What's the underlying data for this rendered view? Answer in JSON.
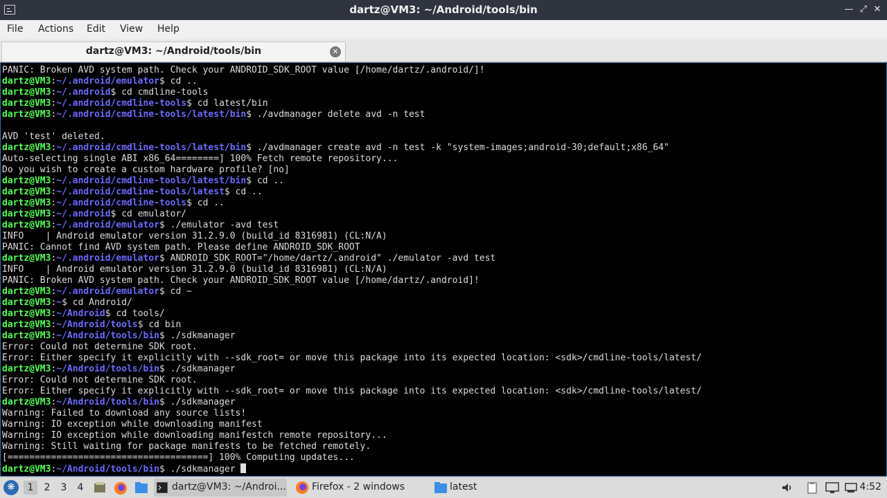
{
  "window": {
    "title": "dartz@VM3: ~/Android/tools/bin",
    "controls": [
      "minimize-icon",
      "maximize-icon",
      "close-icon"
    ]
  },
  "menu": [
    "File",
    "Actions",
    "Edit",
    "View",
    "Help"
  ],
  "tab": {
    "label": "dartz@VM3: ~/Android/tools/bin"
  },
  "terminal": {
    "lines": [
      {
        "text": "PANIC: Broken AVD system path. Check your ANDROID_SDK_ROOT value [/home/dartz/.android/]!"
      },
      {
        "user": "dartz@VM3",
        "path": "~/.android/emulator",
        "cmd": " cd .."
      },
      {
        "user": "dartz@VM3",
        "path": "~/.android",
        "cmd": " cd cmdline-tools"
      },
      {
        "user": "dartz@VM3",
        "path": "~/.android/cmdline-tools",
        "cmd": " cd latest/bin"
      },
      {
        "user": "dartz@VM3",
        "path": "~/.android/cmdline-tools/latest/bin",
        "cmd": " ./avdmanager delete avd -n test"
      },
      {
        "text": ""
      },
      {
        "text": "AVD 'test' deleted."
      },
      {
        "user": "dartz@VM3",
        "path": "~/.android/cmdline-tools/latest/bin",
        "cmd": " ./avdmanager create avd -n test -k \"system-images;android-30;default;x86_64\""
      },
      {
        "text": "Auto-selecting single ABI x86_64========] 100% Fetch remote repository..."
      },
      {
        "text": "Do you wish to create a custom hardware profile? [no]"
      },
      {
        "user": "dartz@VM3",
        "path": "~/.android/cmdline-tools/latest/bin",
        "cmd": " cd .."
      },
      {
        "user": "dartz@VM3",
        "path": "~/.android/cmdline-tools/latest",
        "cmd": " cd .."
      },
      {
        "user": "dartz@VM3",
        "path": "~/.android/cmdline-tools",
        "cmd": " cd .."
      },
      {
        "user": "dartz@VM3",
        "path": "~/.android",
        "cmd": " cd emulator/"
      },
      {
        "user": "dartz@VM3",
        "path": "~/.android/emulator",
        "cmd": " ./emulator -avd test"
      },
      {
        "text": "INFO    | Android emulator version 31.2.9.0 (build_id 8316981) (CL:N/A)"
      },
      {
        "text": "PANIC: Cannot find AVD system path. Please define ANDROID_SDK_ROOT"
      },
      {
        "user": "dartz@VM3",
        "path": "~/.android/emulator",
        "cmd": " ANDROID_SDK_ROOT=\"/home/dartz/.android\" ./emulator -avd test"
      },
      {
        "text": "INFO    | Android emulator version 31.2.9.0 (build_id 8316981) (CL:N/A)"
      },
      {
        "text": "PANIC: Broken AVD system path. Check your ANDROID_SDK_ROOT value [/home/dartz/.android]!"
      },
      {
        "user": "dartz@VM3",
        "path": "~/.android/emulator",
        "cmd": " cd ~"
      },
      {
        "user": "dartz@VM3",
        "path": "~",
        "cmd": " cd Android/"
      },
      {
        "user": "dartz@VM3",
        "path": "~/Android",
        "cmd": " cd tools/"
      },
      {
        "user": "dartz@VM3",
        "path": "~/Android/tools",
        "cmd": " cd bin"
      },
      {
        "user": "dartz@VM3",
        "path": "~/Android/tools/bin",
        "cmd": " ./sdkmanager"
      },
      {
        "text": "Error: Could not determine SDK root."
      },
      {
        "text": "Error: Either specify it explicitly with --sdk_root= or move this package into its expected location: <sdk>/cmdline-tools/latest/"
      },
      {
        "user": "dartz@VM3",
        "path": "~/Android/tools/bin",
        "cmd": " ./sdkmanager"
      },
      {
        "text": "Error: Could not determine SDK root."
      },
      {
        "text": "Error: Either specify it explicitly with --sdk_root= or move this package into its expected location: <sdk>/cmdline-tools/latest/"
      },
      {
        "user": "dartz@VM3",
        "path": "~/Android/tools/bin",
        "cmd": " ./sdkmanager"
      },
      {
        "text": "Warning: Failed to download any source lists!"
      },
      {
        "text": "Warning: IO exception while downloading manifest"
      },
      {
        "text": "Warning: IO exception while downloading manifestch remote repository..."
      },
      {
        "text": "Warning: Still waiting for package manifests to be fetched remotely."
      },
      {
        "text": "[=====================================] 100% Computing updates..."
      },
      {
        "user": "dartz@VM3",
        "path": "~/Android/tools/bin",
        "cmd": " ./sdkmanager ",
        "cursor": true
      }
    ]
  },
  "taskbar": {
    "workspaces": [
      "1",
      "2",
      "3",
      "4"
    ],
    "active_workspace": "1",
    "launchers": [
      "file-manager-icon",
      "firefox-icon",
      "folder-icon"
    ],
    "tasks": [
      {
        "icon": "terminal-icon",
        "label": "dartz@VM3: ~/Androi..."
      },
      {
        "icon": "firefox-icon",
        "label": "Firefox - 2 windows"
      },
      {
        "icon": "folder-icon",
        "label": "latest"
      }
    ],
    "tray": [
      "volume-icon",
      "clipboard-icon",
      "display-icon",
      "network-icon"
    ],
    "clock": "4:52"
  }
}
